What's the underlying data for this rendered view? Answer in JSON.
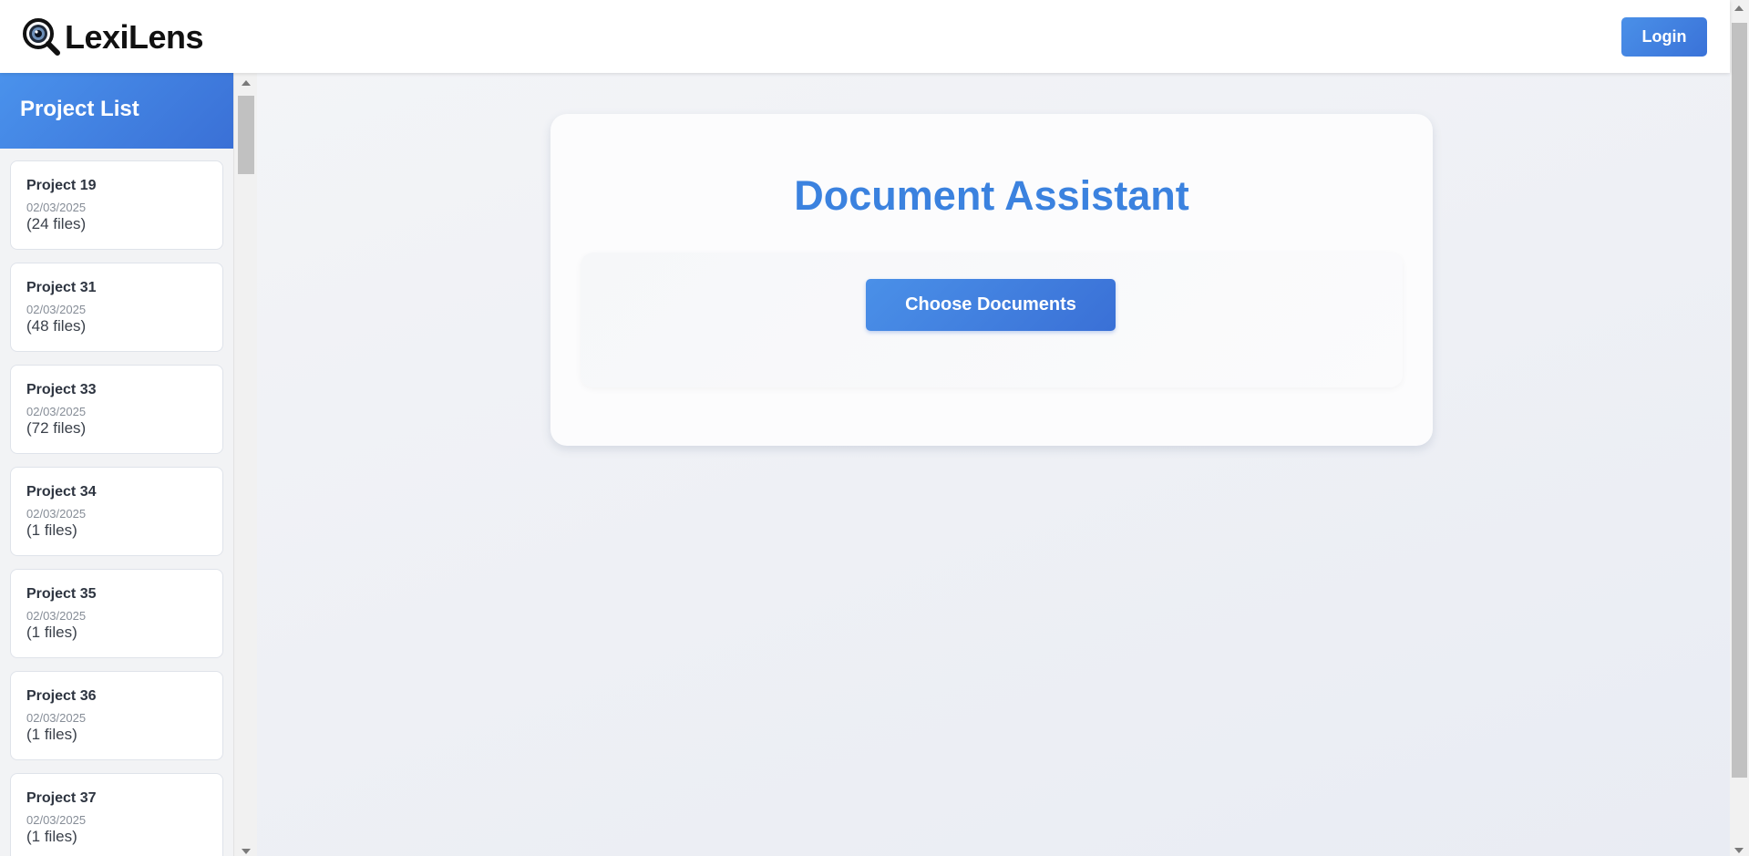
{
  "header": {
    "logo_text": "LexiLens",
    "logo_icon": "magnifier-eye-icon",
    "login_label": "Login"
  },
  "sidebar": {
    "title": "Project List",
    "projects": [
      {
        "name": "Project 19",
        "date": "02/03/2025",
        "files": "(24 files)"
      },
      {
        "name": "Project 31",
        "date": "02/03/2025",
        "files": "(48 files)"
      },
      {
        "name": "Project 33",
        "date": "02/03/2025",
        "files": "(72 files)"
      },
      {
        "name": "Project 34",
        "date": "02/03/2025",
        "files": "(1 files)"
      },
      {
        "name": "Project 35",
        "date": "02/03/2025",
        "files": "(1 files)"
      },
      {
        "name": "Project 36",
        "date": "02/03/2025",
        "files": "(1 files)"
      },
      {
        "name": "Project 37",
        "date": "02/03/2025",
        "files": "(1 files)"
      }
    ]
  },
  "main": {
    "title": "Document Assistant",
    "choose_label": "Choose Documents"
  },
  "colors": {
    "accent": "#3b82df",
    "accent_gradient_start": "#4a90e8",
    "accent_gradient_end": "#3a70d6"
  }
}
